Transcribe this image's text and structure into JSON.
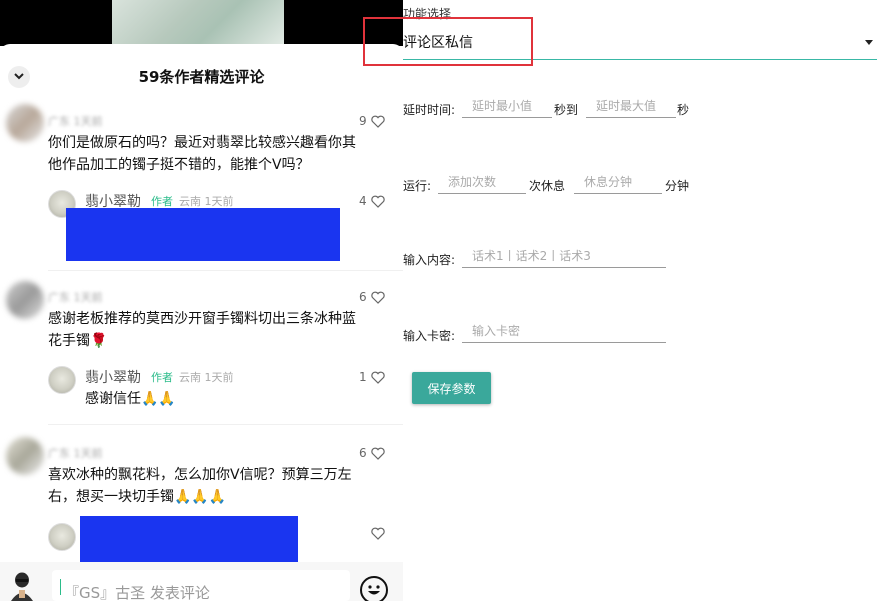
{
  "comments_panel": {
    "title": "59条作者精选评论",
    "comments": [
      {
        "meta": "广东 1天前",
        "text_line1": "你们是做原石的吗？最近对翡翠比较感兴趣看你其",
        "text_line2": "他作品加工的镯子挺不错的，能推个V吗？",
        "likes": "9",
        "reply": {
          "name": "翡小翠勒",
          "author_tag": "作者",
          "meta": "云南 1天前",
          "likes": "4",
          "text": ""
        }
      },
      {
        "meta": "广东 1天前",
        "text_line1": "感谢老板推荐的莫西沙开窗手镯料切出三条冰种蓝",
        "text_line2": "花手镯🌹",
        "likes": "6",
        "reply": {
          "name": "翡小翠勒",
          "author_tag": "作者",
          "meta": "云南 1天前",
          "likes": "1",
          "text": "感谢信任🙏🙏"
        }
      },
      {
        "meta": "广东 1天前",
        "text_line1": "喜欢冰种的飘花料，怎么加你V信呢？预算三万左",
        "text_line2": "右，想买一块切手镯🙏🙏🙏",
        "likes": "6",
        "reply": {
          "name": "",
          "author_tag": "",
          "meta": "",
          "likes": "",
          "text": ""
        }
      }
    ],
    "input": {
      "text": "『GS』古圣 发表评论"
    }
  },
  "form": {
    "function_label": "功能选择",
    "function_value": "评论区私信",
    "delay_label": "延时时间:",
    "delay_min_placeholder": "延时最小值",
    "delay_sec_to": "秒到",
    "delay_max_placeholder": "延时最大值",
    "delay_sec": "秒",
    "run_label": "运行:",
    "run_count_placeholder": "添加次数",
    "run_rest_text": "次休息",
    "rest_minutes_placeholder": "休息分钟",
    "minutes_text": "分钟",
    "content_label": "输入内容:",
    "content_placeholder": "话术1丨话术2丨话术3",
    "card_label": "输入卡密:",
    "card_placeholder": "输入卡密",
    "save_label": "保存参数"
  },
  "colors": {
    "accent_teal": "#3aa89b",
    "highlight_red": "#e0333b",
    "redaction_blue": "#1a35f0",
    "author_green": "#2bbc8a"
  },
  "icons": [
    "chevron-down-icon",
    "heart-icon",
    "emoji-icon",
    "dropdown-arrow-icon"
  ]
}
